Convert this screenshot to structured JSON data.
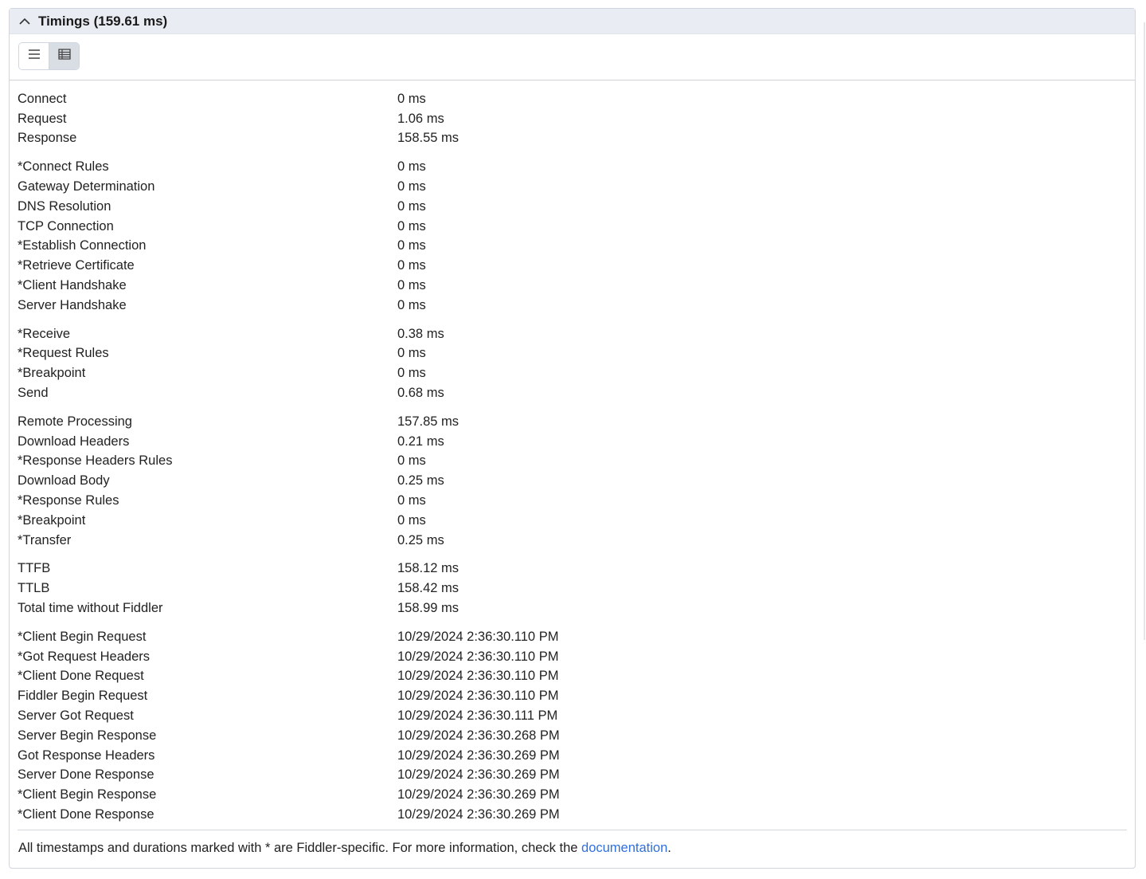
{
  "panel": {
    "title": "Timings (159.61 ms)"
  },
  "toolbar": {
    "list_view_icon": "list-icon",
    "table_view_icon": "table-icon",
    "active_view": "table"
  },
  "groups": [
    {
      "rows": [
        {
          "label": "Connect",
          "value": "0 ms"
        },
        {
          "label": "Request",
          "value": "1.06 ms"
        },
        {
          "label": "Response",
          "value": "158.55 ms"
        }
      ]
    },
    {
      "rows": [
        {
          "label": "*Connect Rules",
          "value": "0 ms"
        },
        {
          "label": "Gateway Determination",
          "value": "0 ms"
        },
        {
          "label": "DNS Resolution",
          "value": "0 ms"
        },
        {
          "label": "TCP Connection",
          "value": "0 ms"
        },
        {
          "label": "*Establish Connection",
          "value": "0 ms"
        },
        {
          "label": "*Retrieve Certificate",
          "value": "0 ms"
        },
        {
          "label": "*Client Handshake",
          "value": "0 ms"
        },
        {
          "label": "Server Handshake",
          "value": "0 ms"
        }
      ]
    },
    {
      "rows": [
        {
          "label": "*Receive",
          "value": "0.38 ms"
        },
        {
          "label": "*Request Rules",
          "value": "0 ms"
        },
        {
          "label": "*Breakpoint",
          "value": "0 ms"
        },
        {
          "label": "Send",
          "value": "0.68 ms"
        }
      ]
    },
    {
      "rows": [
        {
          "label": "Remote Processing",
          "value": "157.85 ms"
        },
        {
          "label": "Download Headers",
          "value": "0.21 ms"
        },
        {
          "label": "*Response Headers Rules",
          "value": "0 ms"
        },
        {
          "label": "Download Body",
          "value": "0.25 ms"
        },
        {
          "label": "*Response Rules",
          "value": "0 ms"
        },
        {
          "label": "*Breakpoint",
          "value": "0 ms"
        },
        {
          "label": "*Transfer",
          "value": "0.25 ms"
        }
      ]
    },
    {
      "rows": [
        {
          "label": "TTFB",
          "value": "158.12 ms"
        },
        {
          "label": "TTLB",
          "value": "158.42 ms"
        },
        {
          "label": "Total time without Fiddler",
          "value": "158.99 ms"
        }
      ]
    },
    {
      "rows": [
        {
          "label": "*Client Begin Request",
          "value": "10/29/2024 2:36:30.110 PM"
        },
        {
          "label": "*Got Request Headers",
          "value": "10/29/2024 2:36:30.110 PM"
        },
        {
          "label": "*Client Done Request",
          "value": "10/29/2024 2:36:30.110 PM"
        },
        {
          "label": "Fiddler Begin Request",
          "value": "10/29/2024 2:36:30.110 PM"
        },
        {
          "label": "Server Got Request",
          "value": "10/29/2024 2:36:30.111 PM"
        },
        {
          "label": "Server Begin Response",
          "value": "10/29/2024 2:36:30.268 PM"
        },
        {
          "label": "Got Response Headers",
          "value": "10/29/2024 2:36:30.269 PM"
        },
        {
          "label": "Server Done Response",
          "value": "10/29/2024 2:36:30.269 PM"
        },
        {
          "label": "*Client Begin Response",
          "value": "10/29/2024 2:36:30.269 PM"
        },
        {
          "label": "*Client Done Response",
          "value": "10/29/2024 2:36:30.269 PM"
        }
      ]
    }
  ],
  "footer": {
    "text_before": "All timestamps and durations marked with * are Fiddler-specific. For more information, check the ",
    "link_text": "documentation",
    "text_after": "."
  },
  "colors": {
    "header_bg": "#e9edf3",
    "link": "#2f6fde",
    "active_segment": "#d9dee5"
  }
}
